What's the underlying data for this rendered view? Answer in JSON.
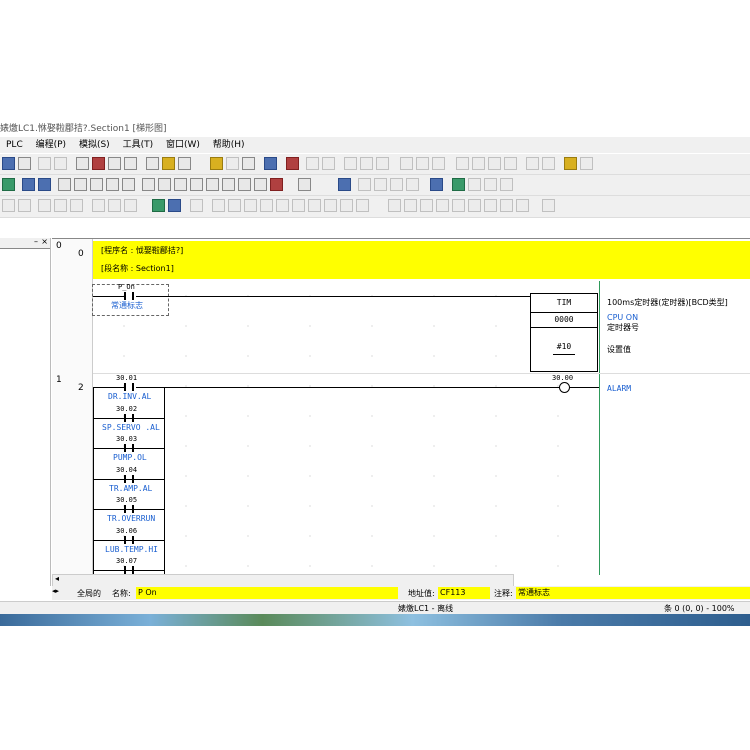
{
  "window": {
    "title": "婊燩LC1.恘娶鞡郿拮?.Section1 [梯形图]"
  },
  "menu": {
    "items": [
      "PLC",
      "编程(P)",
      "模拟(S)",
      "工具(T)",
      "窗口(W)",
      "帮助(H)"
    ]
  },
  "ladder": {
    "section_header": {
      "row_index": "0",
      "program_name": "[程序名 : 怴娶鞡郿拮?]",
      "section_name": "[段名称 : Section1]"
    },
    "rung0": {
      "row_index": "0",
      "number": "0",
      "contact_address": "P_On",
      "contact_comment": "常通标志",
      "timer": {
        "instruction": "TIM",
        "number": "0000",
        "setting": "#10"
      },
      "comment_title": "100ms定时器(定时器)[BCD类型]",
      "comment_cpu": "CPU ON",
      "comment_timer_no": "定时器号",
      "comment_setting": "设置值"
    },
    "rung1": {
      "row_index": "1",
      "number": "2",
      "contacts": [
        {
          "address": "30.01",
          "comment": "DR.INV.AL"
        },
        {
          "address": "30.02",
          "comment": "SP.SERVO .AL"
        },
        {
          "address": "30.03",
          "comment": "PUMP.OL"
        },
        {
          "address": "30.04",
          "comment": "TR.AMP.AL"
        },
        {
          "address": "30.05",
          "comment": "TR.OVERRUN"
        },
        {
          "address": "30.06",
          "comment": "LUB.TEMP.HI"
        },
        {
          "address": "30.07",
          "comment": ""
        }
      ],
      "coil": {
        "address": "30.00",
        "comment": "ALARM"
      }
    }
  },
  "infobar": {
    "scope": "全局的",
    "name_label": "名称:",
    "name_value": "P On",
    "address_label": "地址值:",
    "address_value": "CF113",
    "comment_label": "注释:",
    "comment_value": "常通标志"
  },
  "statusbar": {
    "plc_status": "婊燩LC1 - 离线",
    "position": "条 0 (0, 0)  - 100%"
  },
  "colors": {
    "highlight": "#ffff00",
    "comment_blue": "#1a5fd0",
    "rail_green": "#2e9a5a"
  }
}
